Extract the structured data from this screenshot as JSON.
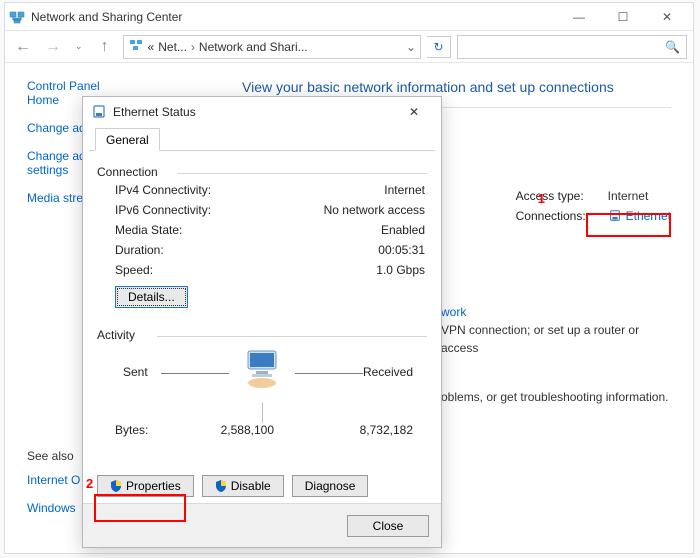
{
  "window": {
    "title": "Network and Sharing Center",
    "crumbs": {
      "root_abbrev": "«",
      "level1": "Net...",
      "level2": "Network and Shari...",
      "search_placeholder": ""
    },
    "nav": {
      "back": "←",
      "forward": "→",
      "up": "↑",
      "refresh": "↻"
    },
    "controls": {
      "minimize": "—",
      "maximize": "☐",
      "close": "✕"
    }
  },
  "sidebar": {
    "links": [
      "Control Panel Home",
      "Change ad",
      "Change ad settings",
      "Media stre"
    ],
    "see_also": {
      "header": "See also",
      "items": [
        "Internet O",
        "Windows"
      ]
    }
  },
  "main": {
    "heading": "View your basic network information and set up connections",
    "info_rows": [
      {
        "label": "Access type:",
        "value": "Internet"
      },
      {
        "label": "Connections:",
        "link": "Ethernet"
      }
    ],
    "section1": {
      "link": "work",
      "text": "VPN connection; or set up a router or access"
    },
    "section2": {
      "text": "oblems, or get troubleshooting information."
    }
  },
  "callouts": {
    "one": "1",
    "two": "2"
  },
  "dialog": {
    "title": "Ethernet Status",
    "tab": "General",
    "groups": {
      "connection": {
        "label": "Connection",
        "items": [
          {
            "k": "IPv4 Connectivity:",
            "v": "Internet"
          },
          {
            "k": "IPv6 Connectivity:",
            "v": "No network access"
          },
          {
            "k": "Media State:",
            "v": "Enabled"
          },
          {
            "k": "Duration:",
            "v": "00:05:31"
          },
          {
            "k": "Speed:",
            "v": "1.0 Gbps"
          }
        ],
        "details_btn": "Details..."
      },
      "activity": {
        "label": "Activity",
        "sent": "Sent",
        "received": "Received",
        "bytes_label": "Bytes:",
        "bytes_sent": "2,588,100",
        "bytes_received": "8,732,182"
      }
    },
    "actions": {
      "properties": "Properties",
      "disable": "Disable",
      "diagnose": "Diagnose"
    },
    "footer": {
      "close": "Close"
    }
  }
}
